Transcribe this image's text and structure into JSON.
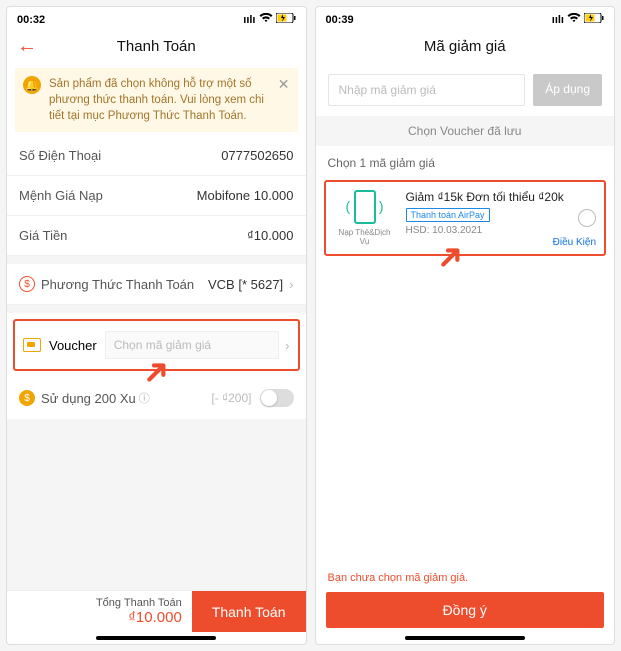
{
  "left": {
    "status_time": "00:32",
    "header_title": "Thanh Toán",
    "alert_text": "Sản phẩm đã chọn không hỗ trợ một số phương thức thanh toán. Vui lòng xem chi tiết tại mục Phương Thức Thanh Toán.",
    "rows": {
      "phone_label": "Số Điện Thoại",
      "phone_value": "0777502650",
      "denom_label": "Mệnh Giá Nạp",
      "denom_value": "Mobifone 10.000",
      "price_label": "Giá Tiền",
      "price_value": "₫10.000",
      "pay_method_label": "Phương Thức Thanh Toán",
      "pay_method_value": "VCB [* 5627]"
    },
    "voucher": {
      "label": "Voucher",
      "placeholder": "Chọn mã giảm giá"
    },
    "xu": {
      "label": "Sử dụng 200 Xu",
      "amount": "[- ₫200]"
    },
    "bottom": {
      "total_label": "Tổng Thanh Toán",
      "total_value": "₫10.000",
      "pay_btn": "Thanh Toán"
    }
  },
  "right": {
    "status_time": "00:39",
    "header_title": "Mã giảm giá",
    "code_placeholder": "Nhập mã giảm giá",
    "apply_btn": "Áp dụng",
    "saved_label": "Chọn Voucher đã lưu",
    "choose_one": "Chọn 1 mã giảm giá",
    "voucher": {
      "stub_caption": "Nạp Thẻ&Dịch Vụ",
      "title": "Giảm ₫15k Đơn tối thiểu ₫20k",
      "pay_badge": "Thanh toán AirPay",
      "hsd": "HSD: 10.03.2021",
      "terms": "Điều Kiện"
    },
    "not_chosen": "Bạn chưa chọn mã giảm giá.",
    "agree_btn": "Đồng ý"
  }
}
